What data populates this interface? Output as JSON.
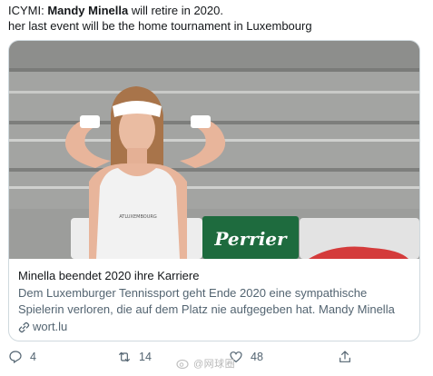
{
  "tweet": {
    "prefix": "ICYMI: ",
    "name": "Mandy Minella",
    "line1_rest": " will retire in 2020.",
    "line2": "her last event will be the home tournament in Luxembourg"
  },
  "card": {
    "image_text": {
      "shirt_text": "ATLUXEMBOURG",
      "sign_text": "Perrier"
    },
    "title": "Minella beendet 2020 ihre Karriere",
    "description": "Dem Luxemburger Tennissport geht Ende 2020 eine sympathische Spielerin verloren, die auf dem Platz nie aufgegeben hat. Mandy Minella",
    "domain": "wort.lu"
  },
  "actions": {
    "reply_count": "4",
    "retweet_count": "14",
    "like_count": "48"
  },
  "watermark": "@网球圈",
  "colors": {
    "text": "#14171a",
    "secondary": "#536471",
    "border": "#cfd9de",
    "perrier_green": "#1e6b3e"
  }
}
